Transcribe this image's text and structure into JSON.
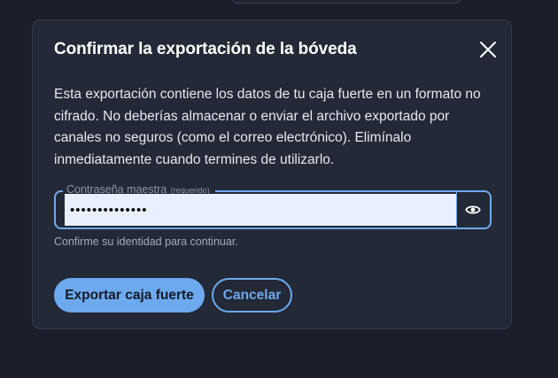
{
  "dialog": {
    "title": "Confirmar la exportación de la bóveda",
    "close_icon": "close-icon",
    "message": "Esta exportación contiene los datos de tu caja fuerte en un formato no cifrado. No deberías almacenar o enviar el archivo exportado por canales no seguros (como el correo electrónico). Elimínalo inmediatamente cuando termines de utilizarlo.",
    "password_field": {
      "label": "Contraseña maestra",
      "required_note": "(requerido)",
      "value": "••••••••••••••",
      "toggle_icon": "eye-icon"
    },
    "hint": "Confirme su identidad para continuar.",
    "buttons": {
      "export_label": "Exportar caja fuerte",
      "cancel_label": "Cancelar"
    }
  },
  "colors": {
    "background": "#1b1f29",
    "dialog_background": "#232936",
    "accent": "#6da9ef",
    "input_background": "#e8f0fe",
    "text_primary": "#ffffff",
    "text_muted": "#a4abb8"
  }
}
